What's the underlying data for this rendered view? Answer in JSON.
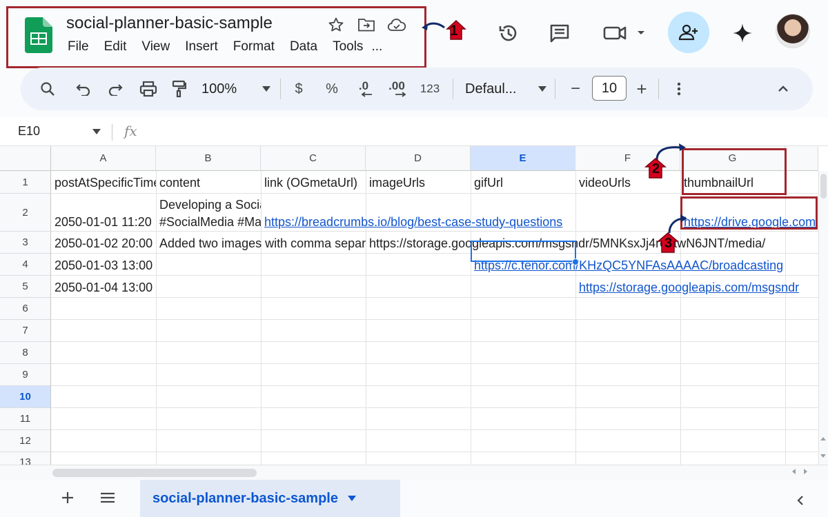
{
  "app": {
    "title": "social-planner-basic-sample",
    "menu": [
      "File",
      "Edit",
      "View",
      "Insert",
      "Format",
      "Data",
      "Tools",
      "..."
    ]
  },
  "toolbar": {
    "zoom": "100%",
    "currency": "$",
    "percent": "%",
    "decrease_decimal": ".0",
    "increase_decimal": ".00",
    "number_format": "123",
    "font": "Defaul...",
    "font_size": "10",
    "minus": "−",
    "plus": "+"
  },
  "formula_bar": {
    "cell_ref": "E10",
    "fx": "fx"
  },
  "columns": [
    "A",
    "B",
    "C",
    "D",
    "E",
    "F",
    "G"
  ],
  "rows": [
    "1",
    "2",
    "3",
    "4",
    "5",
    "6",
    "7",
    "8",
    "9",
    "10",
    "11",
    "12",
    "13"
  ],
  "cells": {
    "A1": "postAtSpecificTime",
    "B1": "content",
    "C1": "link (OGmetaUrl)",
    "D1": "imageUrls",
    "E1": "gifUrl",
    "F1": "videoUrls",
    "G1": "thumbnailUrl",
    "A2": "2050-01-01 11:20",
    "B2_line1": "Developing a Social",
    "B2_line2": "#SocialMedia #Marketing",
    "C2": "https://breadcrumbs.io/blog/best-case-study-questions",
    "G2": "https://drive.google.com",
    "A3": "2050-01-02 20:00",
    "B3": "Added two images with comma separated",
    "D3": "https://storage.googleapis.com/msgsndr/5MNKsxJj4roqtwN6JNT/media/",
    "A4": "2050-01-03 13:00",
    "E4": "https://c.tenor.com/KHzQC5YNFAsAAAAC/broadcasting",
    "A5": "2050-01-04 13:00",
    "F5": "https://storage.googleapis.com/msgsndr"
  },
  "annotations": {
    "one": "1",
    "two": "2",
    "three": "3"
  },
  "sheet_tab": {
    "name": "social-planner-basic-sample"
  },
  "colors": {
    "highlight": "#a3262d",
    "link": "#1155cc",
    "selection": "#1a73e8",
    "annotation": "#d4021e"
  }
}
